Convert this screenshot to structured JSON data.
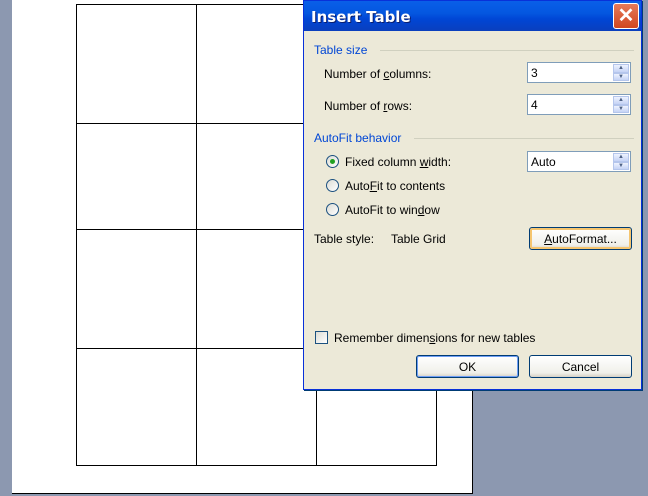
{
  "dialog": {
    "title": "Insert Table",
    "close_icon": "close-x-icon",
    "table_size": {
      "label": "Table size",
      "columns_label_pre": "Number of ",
      "columns_label_key": "c",
      "columns_label_post": "olumns:",
      "columns_value": "3",
      "rows_label_pre": "Number of ",
      "rows_label_key": "r",
      "rows_label_post": "ows:",
      "rows_value": "4"
    },
    "autofit": {
      "label": "AutoFit behavior",
      "fixed_pre": "Fixed column ",
      "fixed_key": "w",
      "fixed_post": "idth:",
      "fixed_value": "Auto",
      "contents_pre": "Auto",
      "contents_key": "F",
      "contents_post": "it to contents",
      "window_pre": "AutoFit to win",
      "window_key": "d",
      "window_post": "ow",
      "selected": "fixed"
    },
    "table_style": {
      "label": "Table style:",
      "value": "Table Grid",
      "autoformat_key": "A",
      "autoformat_post": "utoFormat..."
    },
    "remember": {
      "pre": "Remember dimen",
      "key": "s",
      "post": "ions for new tables",
      "checked": false
    },
    "ok_label": "OK",
    "cancel_label": "Cancel"
  },
  "colors": {
    "titlebar": "#0055e5",
    "dialog_bg": "#ece9d8",
    "group_label": "#0046d5",
    "desktop": "#8c98b0"
  }
}
